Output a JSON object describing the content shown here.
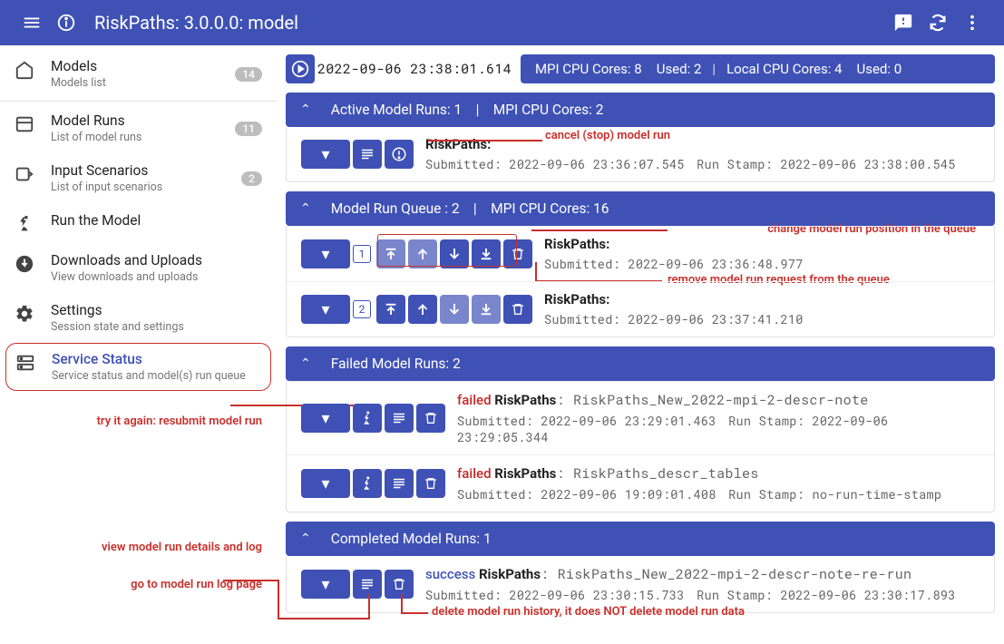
{
  "header": {
    "title": "RiskPaths: 3.0.0.0: model"
  },
  "sidebar": {
    "items": [
      {
        "label": "Models",
        "sub": "Models list",
        "badge": "14"
      },
      {
        "label": "Model Runs",
        "sub": "List of model runs",
        "badge": "11"
      },
      {
        "label": "Input Scenarios",
        "sub": "List of input scenarios",
        "badge": "2"
      },
      {
        "label": "Run the Model",
        "sub": ""
      },
      {
        "label": "Downloads and Uploads",
        "sub": "View downloads and uploads"
      },
      {
        "label": "Settings",
        "sub": "Session state and settings"
      },
      {
        "label": "Service Status",
        "sub": "Service status and model(s) run queue"
      }
    ]
  },
  "status": {
    "timestamp": "2022-09-06 23:38:01.614",
    "mpi_cores_label": "MPI CPU Cores: 8",
    "mpi_used_label": "Used: 2",
    "local_cores_label": "Local CPU Cores: 4",
    "local_used_label": "Used: 0"
  },
  "sections": {
    "active": {
      "title": "Active Model Runs: 1    |    MPI CPU Cores: 2",
      "runs": [
        {
          "name": "RiskPaths:",
          "submitted": "Submitted: 2022-09-06 23:36:07.545",
          "stamp": "Run Stamp: 2022-09-06 23:38:00.545"
        }
      ]
    },
    "queue": {
      "title": "Model Run Queue : 2    |    MPI CPU Cores: 16",
      "runs": [
        {
          "pos": "1",
          "name": "RiskPaths:",
          "submitted": "Submitted: 2022-09-06 23:36:48.977"
        },
        {
          "pos": "2",
          "name": "RiskPaths:",
          "submitted": "Submitted: 2022-09-06 23:37:41.210"
        }
      ]
    },
    "failed": {
      "title": "Failed Model Runs: 2",
      "runs": [
        {
          "status": "failed",
          "name": "RiskPaths",
          "detail": ": RiskPaths_New_2022-mpi-2-descr-note",
          "submitted": "Submitted: 2022-09-06 23:29:01.463",
          "stamp": "Run Stamp: 2022-09-06 23:29:05.344"
        },
        {
          "status": "failed",
          "name": "RiskPaths",
          "detail": ": RiskPaths_descr_tables",
          "submitted": "Submitted: 2022-09-06 19:09:01.408",
          "stamp": "Run Stamp: no-run-time-stamp"
        }
      ]
    },
    "completed": {
      "title": "Completed Model Runs: 1",
      "runs": [
        {
          "status": "success",
          "name": "RiskPaths",
          "detail": ": RiskPaths_New_2022-mpi-2-descr-note-re-run",
          "submitted": "Submitted: 2022-09-06 23:30:15.733",
          "stamp": "Run Stamp: 2022-09-06 23:30:17.893"
        }
      ]
    }
  },
  "annotations": {
    "cancel": "cancel (stop) model run",
    "change_pos": "change model run position in the queue",
    "remove": "remove model run request from the queue",
    "resubmit": "try it again: resubmit model run",
    "view_details": "view model run details and log",
    "goto_log": "go to model run log page",
    "delete_history": "delete model run history, it does NOT delete model run data"
  }
}
